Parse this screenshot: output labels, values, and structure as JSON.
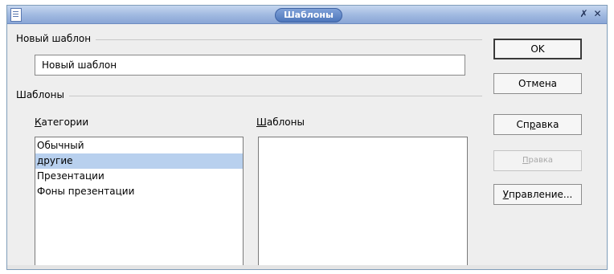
{
  "window": {
    "title": "Шаблоны",
    "pin_glyph": "✗",
    "close_glyph": "✕",
    "accent": "#4d76bb"
  },
  "new_template": {
    "group_label": "Новый шаблон",
    "value": "Новый шаблон"
  },
  "templates_group": {
    "group_label": "Шаблоны",
    "categories_label_first": "К",
    "categories_label_rest": "атегории",
    "templates_label_first": "Ш",
    "templates_label_rest": "аблоны",
    "categories": [
      {
        "label": "Обычный"
      },
      {
        "label": "другие"
      },
      {
        "label": "Презентации"
      },
      {
        "label": "Фоны презентации"
      }
    ],
    "selected_category": "другие",
    "templates": []
  },
  "buttons": {
    "ok": "OK",
    "cancel": "Отмена",
    "help_pre": "Сп",
    "help_mnemonic": "р",
    "help_post": "авка",
    "edit_mnemonic": "П",
    "edit_post": "равка",
    "manage_mnemonic": "У",
    "manage_post": "правление..."
  }
}
